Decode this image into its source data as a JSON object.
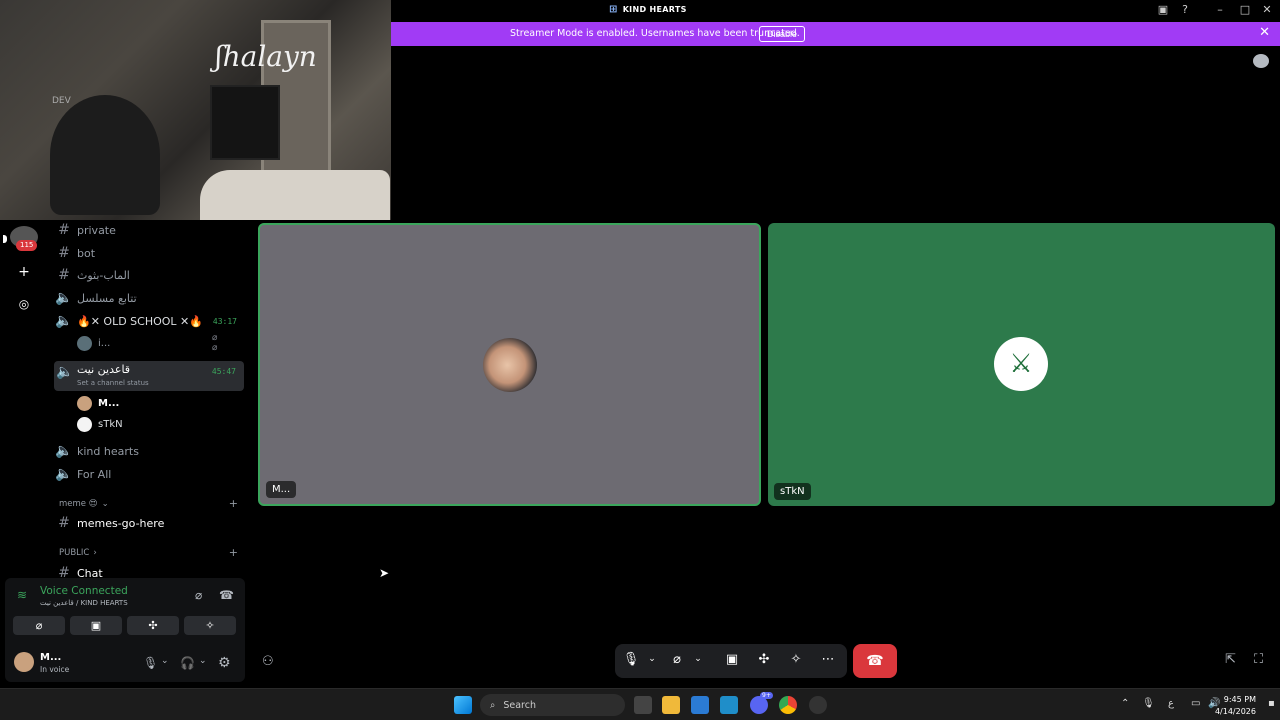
{
  "window": {
    "title": "KIND HEARTS"
  },
  "banner": {
    "text": "Streamer Mode is enabled. Usernames have been truncated.",
    "button": "Disable",
    "close": "✕"
  },
  "webcam": {
    "neon_text": "ʃhalayn",
    "poster_text": "DEV"
  },
  "rail": {
    "badge": "115"
  },
  "channels": [
    {
      "name": "private",
      "type": "text"
    },
    {
      "name": "bot",
      "type": "text"
    },
    {
      "name": "الماب-بثوث",
      "type": "text"
    },
    {
      "name": "تتابع مسلسل",
      "type": "voice"
    },
    {
      "name": "🔥✕ OLD SCHOOL ✕🔥",
      "type": "voice",
      "timer": "43:17"
    },
    {
      "name": "قاعدين نيت",
      "type": "voice",
      "timer": "45:47",
      "status": "Set a channel status"
    },
    {
      "name": "kind hearts",
      "type": "voice"
    },
    {
      "name": "For All",
      "type": "voice"
    }
  ],
  "members": {
    "old_school": [
      {
        "name": "i..."
      }
    ],
    "current": [
      {
        "name": "M..."
      },
      {
        "name": "sTkN"
      }
    ]
  },
  "categories": [
    {
      "name": "meme 😍",
      "channels": [
        "memes-go-here"
      ]
    },
    {
      "name": "PUBLIC",
      "channels": [
        "Chat"
      ]
    }
  ],
  "voice_panel": {
    "title": "Voice Connected",
    "subtitle": "قاعدين نيت / KIND HEARTS",
    "user_name": "M...",
    "user_status": "In voice"
  },
  "tiles": [
    {
      "label": "M...",
      "bg": "#6d6b72",
      "border": "#3ba55c"
    },
    {
      "label": "sTkN",
      "bg": "#2d7a4b"
    }
  ],
  "taskbar": {
    "search_placeholder": "Search",
    "lang": "ع",
    "time": "9:45 PM",
    "date": "4/14/2026",
    "discord_badge": "9+"
  },
  "colors": {
    "accent": "#a13bf5",
    "voice_green": "#3ba55c",
    "hangup_red": "#da373c"
  }
}
